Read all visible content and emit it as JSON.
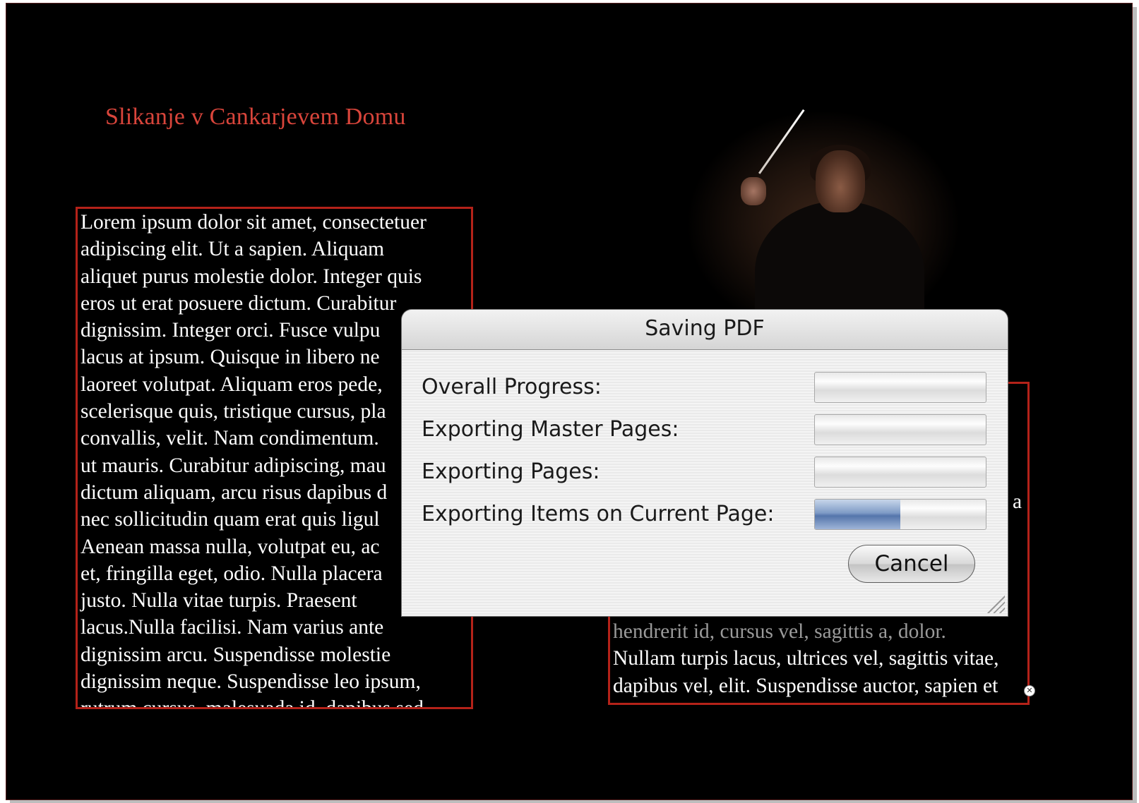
{
  "document": {
    "title": "Slikanje v Cankarjevem Domu",
    "left_frame_lines": [
      "Lorem ipsum dolor sit amet, consectetuer",
      "adipiscing elit. Ut a sapien. Aliquam",
      "aliquet purus molestie dolor. Integer quis",
      "eros ut erat posuere dictum. Curabitur",
      "dignissim. Integer orci. Fusce vulpu",
      "lacus at ipsum. Quisque in libero ne",
      "laoreet volutpat. Aliquam eros pede,",
      "scelerisque quis, tristique cursus, pla",
      "convallis, velit. Nam condimentum.",
      "ut mauris. Curabitur adipiscing, mau",
      "dictum aliquam, arcu risus dapibus d",
      "nec sollicitudin quam erat quis ligul",
      "Aenean massa nulla, volutpat eu, ac",
      "et, fringilla eget, odio. Nulla placera",
      "justo. Nulla vitae turpis. Praesent",
      "lacus.Nulla facilisi. Nam varius ante",
      "dignissim arcu. Suspendisse molestie",
      "dignissim neque. Suspendisse leo ipsum,",
      "rutrum cursus, malesuada id, dapibus sed,"
    ],
    "right_frame_stub": "a",
    "right_frame_lines": [
      "hendrerit id, cursus vel, sagittis a, dolor.",
      "Nullam turpis lacus, ultrices vel, sagittis vitae,",
      "dapibus vel, elit. Suspendisse auctor, sapien et"
    ],
    "overset_icon": "overset-x-icon"
  },
  "dialog": {
    "title": "Saving PDF",
    "rows": [
      {
        "label": "Overall Progress:",
        "progress": 0
      },
      {
        "label": "Exporting Master Pages:",
        "progress": 0
      },
      {
        "label": "Exporting Pages:",
        "progress": 0
      },
      {
        "label": "Exporting Items on Current Page:",
        "progress": 0.5
      }
    ],
    "cancel_label": "Cancel",
    "progress_color": "#5475ab"
  }
}
